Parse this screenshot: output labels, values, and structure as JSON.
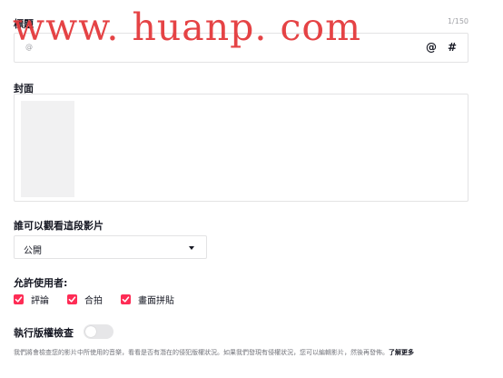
{
  "watermark": {
    "text": "www. huanp. com"
  },
  "caption": {
    "label": "標題",
    "counter": "1/150",
    "placeholder": "@",
    "mention_symbol": "@",
    "hashtag_symbol": "#"
  },
  "cover": {
    "label": "封面"
  },
  "privacy": {
    "label": "誰可以觀看這段影片",
    "value": "公開"
  },
  "allow": {
    "label": "允許使用者:",
    "options": [
      {
        "label": "評論",
        "checked": true
      },
      {
        "label": "合拍",
        "checked": true
      },
      {
        "label": "畫面拼貼",
        "checked": true
      }
    ]
  },
  "copyright": {
    "label": "執行版權檢查",
    "enabled": false,
    "description": "我們將會檢查您的影片中所使用的音樂，看看是否有潛在的侵犯版權狀況。如果我們發現有侵權狀況，您可以編輯影片，然後再發佈。",
    "learn_more": "了解更多"
  },
  "colors": {
    "accent": "#fe2c55",
    "watermark": "#e4393c",
    "border": "#e3e3e4"
  }
}
